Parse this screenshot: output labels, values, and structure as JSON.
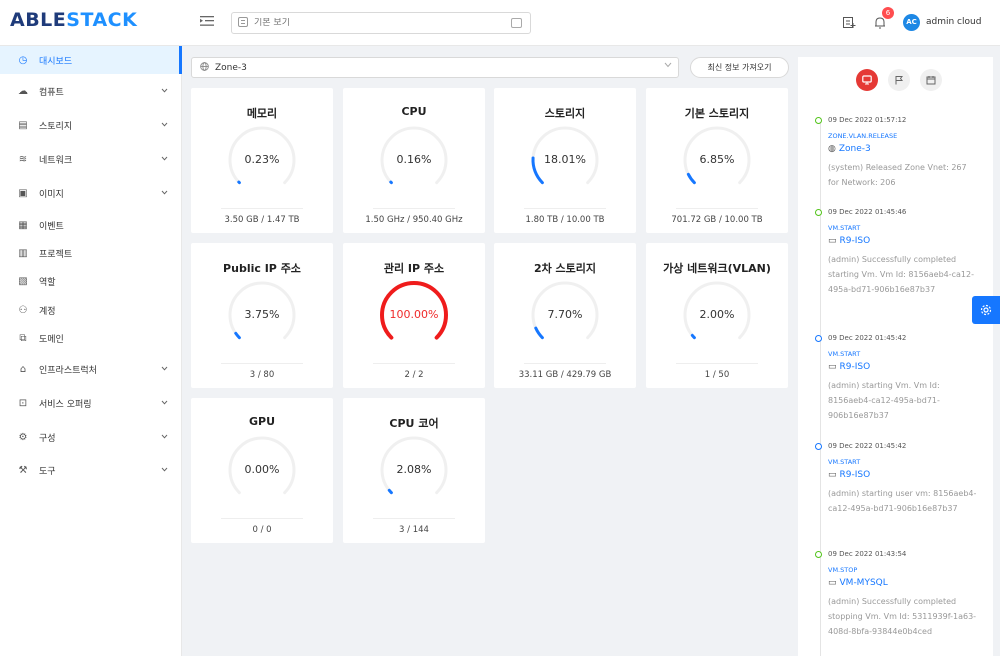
{
  "header": {
    "logo_a": "ABLE",
    "logo_b": "STACK",
    "search_placeholder": "기본 보기",
    "notification_count": "6",
    "avatar_initials": "AC",
    "username": "admin cloud"
  },
  "sidebar": {
    "items": [
      {
        "label": "대시보드",
        "icon": "dashboard-icon",
        "glyph": "◷",
        "expandable": false,
        "active": true
      },
      {
        "label": "컴퓨트",
        "icon": "cloud-icon",
        "glyph": "☁",
        "expandable": true
      },
      {
        "label": "스토리지",
        "icon": "database-icon",
        "glyph": "▤",
        "expandable": true
      },
      {
        "label": "네트워크",
        "icon": "wifi-icon",
        "glyph": "≋",
        "expandable": true
      },
      {
        "label": "이미지",
        "icon": "image-icon",
        "glyph": "▣",
        "expandable": true
      },
      {
        "label": "이벤트",
        "icon": "schedule-icon",
        "glyph": "▦",
        "expandable": false
      },
      {
        "label": "프로젝트",
        "icon": "project-icon",
        "glyph": "▥",
        "expandable": false
      },
      {
        "label": "역할",
        "icon": "idcard-icon",
        "glyph": "▧",
        "expandable": false
      },
      {
        "label": "계정",
        "icon": "team-icon",
        "glyph": "⚇",
        "expandable": false
      },
      {
        "label": "도메인",
        "icon": "block-icon",
        "glyph": "⧉",
        "expandable": false
      },
      {
        "label": "인프라스트럭처",
        "icon": "bank-icon",
        "glyph": "⌂",
        "expandable": true
      },
      {
        "label": "서비스 오퍼링",
        "icon": "shopping-icon",
        "glyph": "⊡",
        "expandable": true
      },
      {
        "label": "구성",
        "icon": "setting-icon",
        "glyph": "⚙",
        "expandable": true
      },
      {
        "label": "도구",
        "icon": "tool-icon",
        "glyph": "⚒",
        "expandable": true
      }
    ]
  },
  "zone": {
    "selected": "Zone-3",
    "refresh_label": "최신 정보 가져오기"
  },
  "cards": [
    {
      "title": "메모리",
      "value": "0.23%",
      "percent": 0.23,
      "footer": "3.50 GB / 1.47 TB"
    },
    {
      "title": "CPU",
      "value": "0.16%",
      "percent": 0.16,
      "footer": "1.50 GHz / 950.40 GHz"
    },
    {
      "title": "스토리지",
      "value": "18.01%",
      "percent": 18.01,
      "footer": "1.80 TB / 10.00 TB"
    },
    {
      "title": "기본 스토리지",
      "value": "6.85%",
      "percent": 6.85,
      "footer": "701.72 GB / 10.00 TB"
    },
    {
      "title": "Public IP 주소",
      "value": "3.75%",
      "percent": 3.75,
      "footer": "3 / 80"
    },
    {
      "title": "관리 IP 주소",
      "value": "100.00%",
      "percent": 100,
      "footer": "2 / 2",
      "danger": true
    },
    {
      "title": "2차 스토리지",
      "value": "7.70%",
      "percent": 7.7,
      "footer": "33.11 GB / 429.79 GB"
    },
    {
      "title": "가상 네트워크(VLAN)",
      "value": "2.00%",
      "percent": 2.0,
      "footer": "1 / 50"
    },
    {
      "title": "GPU",
      "value": "0.00%",
      "percent": 0,
      "footer": "0 / 0"
    },
    {
      "title": "CPU 코어",
      "value": "2.08%",
      "percent": 2.08,
      "footer": "3 / 144"
    }
  ],
  "colors": {
    "gauge_normal": "#1677ff",
    "gauge_danger": "#ef1c1c",
    "gauge_track": "#f0f0f0"
  },
  "events": [
    {
      "time": "09 Dec 2022 01:57:12",
      "type": "ZONE.VLAN.RELEASE",
      "target": "Zone-3",
      "target_icon": "globe-icon",
      "description": "(system) Released Zone Vnet: 267 for Network: 206",
      "status": "green"
    },
    {
      "time": "09 Dec 2022 01:45:46",
      "type": "VM.START",
      "target": "R9-ISO",
      "target_icon": "desktop-icon",
      "description": "(admin) Successfully completed starting Vm. Vm Id: 8156aeb4-ca12-495a-bd71-906b16e87b37",
      "status": "green"
    },
    {
      "time": "09 Dec 2022 01:45:42",
      "type": "VM.START",
      "target": "R9-ISO",
      "target_icon": "desktop-icon",
      "description": "(admin) starting Vm. Vm Id: 8156aeb4-ca12-495a-bd71-906b16e87b37",
      "status": "blue"
    },
    {
      "time": "09 Dec 2022 01:45:42",
      "type": "VM.START",
      "target": "R9-ISO",
      "target_icon": "desktop-icon",
      "description": "(admin) starting user vm: 8156aeb4-ca12-495a-bd71-906b16e87b37",
      "status": "blue"
    },
    {
      "time": "09 Dec 2022 01:43:54",
      "type": "VM.STOP",
      "target": "VM-MYSQL",
      "target_icon": "desktop-icon",
      "description": "(admin) Successfully completed stopping Vm. Vm Id: 5311939f-1a63-408d-8bfa-93844e0b4ced",
      "status": "green"
    }
  ]
}
